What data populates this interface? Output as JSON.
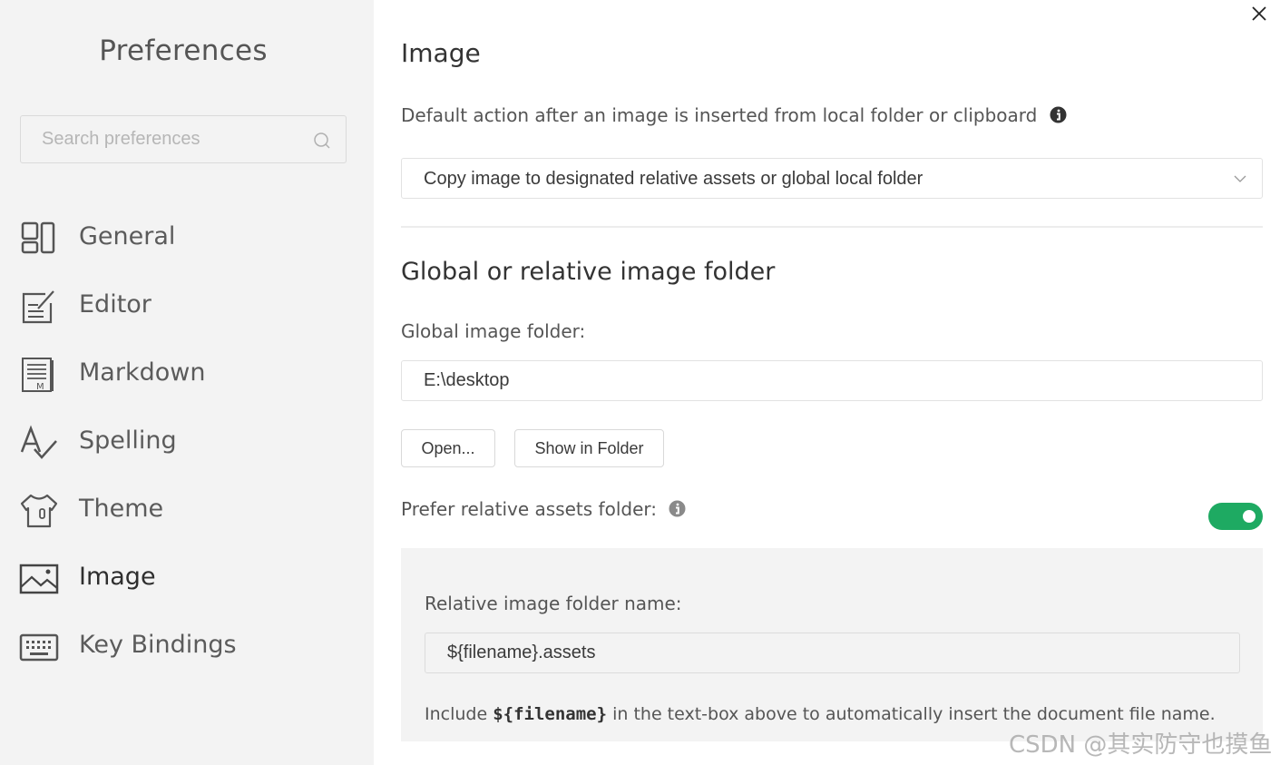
{
  "sidebar": {
    "title": "Preferences",
    "search_placeholder": "Search preferences",
    "items": [
      {
        "label": "General",
        "icon": "general-icon"
      },
      {
        "label": "Editor",
        "icon": "editor-icon"
      },
      {
        "label": "Markdown",
        "icon": "markdown-icon"
      },
      {
        "label": "Spelling",
        "icon": "spelling-icon"
      },
      {
        "label": "Theme",
        "icon": "theme-icon"
      },
      {
        "label": "Image",
        "icon": "image-icon",
        "active": true
      },
      {
        "label": "Key Bindings",
        "icon": "keyboard-icon"
      }
    ]
  },
  "main": {
    "title": "Image",
    "default_action_label": "Default action after an image is inserted from local folder or clipboard",
    "default_action_value": "Copy image to designated relative assets or global local folder",
    "folder_section_title": "Global or relative image folder",
    "global_folder_label": "Global image folder:",
    "global_folder_value": "E:\\desktop",
    "open_button": "Open...",
    "show_in_folder_button": "Show in Folder",
    "prefer_relative_label": "Prefer relative assets folder:",
    "prefer_relative_enabled": true,
    "relative_folder_label": "Relative image folder name:",
    "relative_folder_value": "${filename}.assets",
    "note_prefix": "Include ",
    "note_code": "${filename}",
    "note_suffix": " in the text-box above to automatically insert the document file name."
  },
  "watermark": "CSDN @其实防守也摸鱼",
  "colors": {
    "toggle_on": "#1eaa62",
    "sidebar_bg": "#f3f3f3"
  }
}
